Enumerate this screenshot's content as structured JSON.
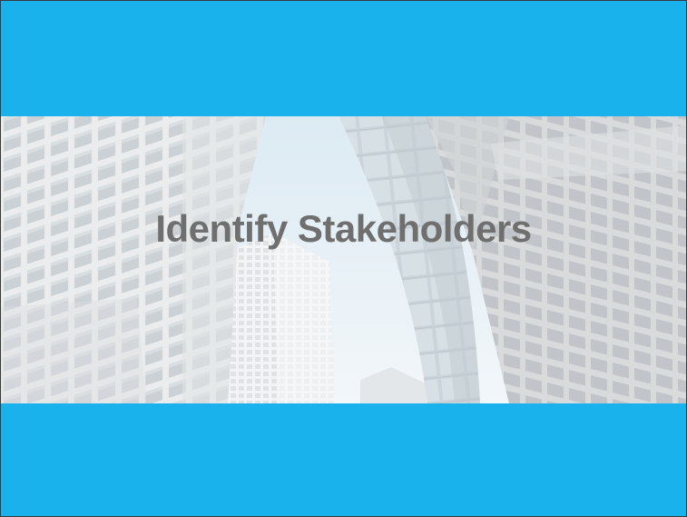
{
  "slide": {
    "title": "Identify Stakeholders",
    "background_color": "#1ab2ec",
    "title_color": "#6f6f6f",
    "photo": "skyscrapers-looking-up-image"
  }
}
